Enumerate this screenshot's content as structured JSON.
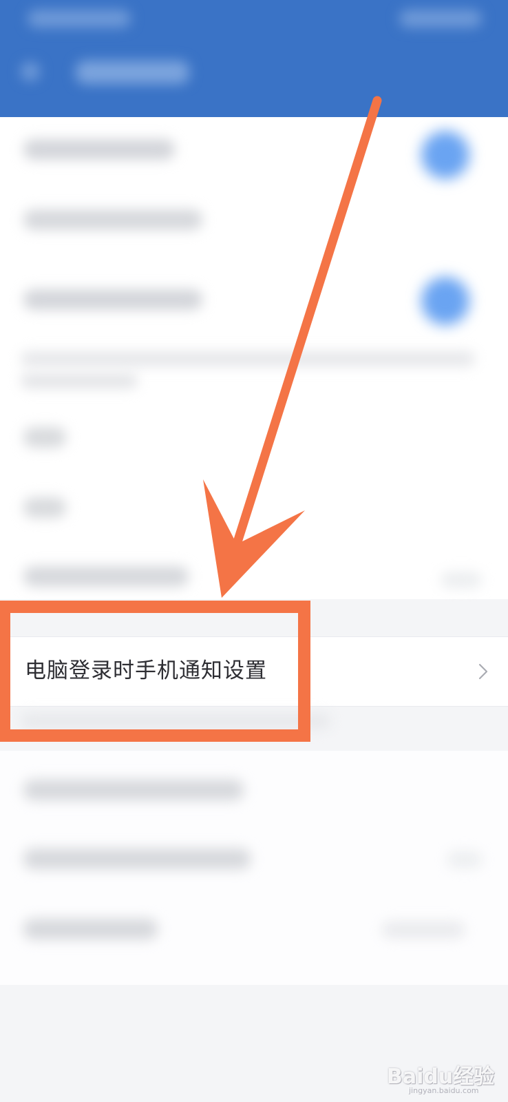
{
  "settings": {
    "focused_item_label": "电脑登录时手机通知设置"
  },
  "icons": {
    "chevron": "chevron-right-icon"
  },
  "colors": {
    "header_blue": "#3a73c6",
    "toggle_blue": "#6aa4f2",
    "annotation_orange": "#f47446",
    "page_background": "#f4f5f7"
  },
  "watermark": {
    "text": "Baidu经验",
    "subtext": "jingyan.baidu.com"
  }
}
